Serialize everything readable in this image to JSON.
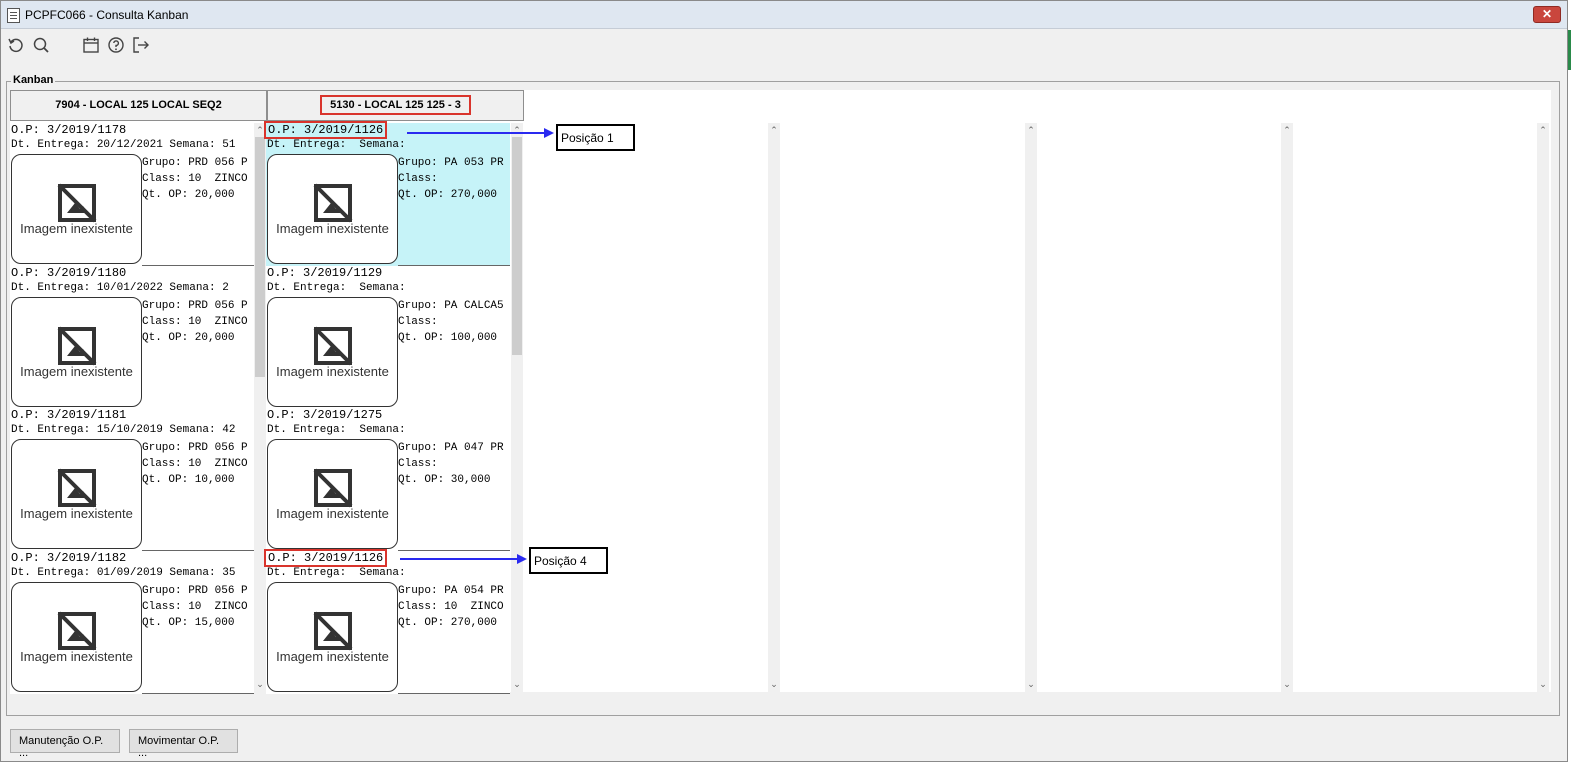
{
  "window": {
    "title": "PCPFC066 - Consulta Kanban",
    "close_label": "✕"
  },
  "toolbar": {
    "icons": [
      "refresh-icon",
      "search-icon",
      "calendar-icon",
      "help-icon",
      "exit-icon"
    ]
  },
  "group": {
    "label": "Kanban"
  },
  "columns": [
    {
      "header": "7904 - LOCAL 125 LOCAL SEQ2",
      "cards": [
        {
          "op": "O.P: 3/2019/1178",
          "dt": "Dt. Entrega: 20/12/2021 Semana: 51",
          "grupo": "Grupo: PRD 056 P",
          "class": "Class: 10  ZINCO",
          "qt": "Qt. OP: 20,000",
          "img_caption": "Imagem inexistente"
        },
        {
          "op": "O.P: 3/2019/1180",
          "dt": "Dt. Entrega: 10/01/2022 Semana: 2",
          "grupo": "Grupo: PRD 056 P",
          "class": "Class: 10  ZINCO",
          "qt": "Qt. OP: 20,000",
          "img_caption": "Imagem inexistente"
        },
        {
          "op": "O.P: 3/2019/1181",
          "dt": "Dt. Entrega: 15/10/2019 Semana: 42",
          "grupo": "Grupo: PRD 056 P",
          "class": "Class: 10  ZINCO",
          "qt": "Qt. OP: 10,000",
          "img_caption": "Imagem inexistente"
        },
        {
          "op": "O.P: 3/2019/1182",
          "dt": "Dt. Entrega: 01/09/2019 Semana: 35",
          "grupo": "Grupo: PRD 056 P",
          "class": "Class: 10  ZINCO",
          "qt": "Qt. OP: 15,000",
          "img_caption": "Imagem inexistente"
        }
      ]
    },
    {
      "header": "5130 - LOCAL 125 125 - 3",
      "cards": [
        {
          "op": "O.P: 3/2019/1126",
          "dt": "Dt. Entrega:  Semana:",
          "grupo": "Grupo: PA 053 PR",
          "class": "Class:",
          "qt": "Qt. OP: 270,000",
          "img_caption": "Imagem inexistente"
        },
        {
          "op": "O.P: 3/2019/1129",
          "dt": "Dt. Entrega:  Semana:",
          "grupo": "Grupo: PA CALCA5",
          "class": "Class:",
          "qt": "Qt. OP: 100,000",
          "img_caption": "Imagem inexistente"
        },
        {
          "op": "O.P: 3/2019/1275",
          "dt": "Dt. Entrega:  Semana:",
          "grupo": "Grupo: PA 047 PR",
          "class": "Class:",
          "qt": "Qt. OP: 30,000",
          "img_caption": "Imagem inexistente"
        },
        {
          "op": "O.P: 3/2019/1126",
          "dt": "Dt. Entrega:  Semana:",
          "grupo": "Grupo: PA 054 PR",
          "class": "Class: 10  ZINCO",
          "qt": "Qt. OP: 270,000",
          "img_caption": "Imagem inexistente"
        }
      ]
    }
  ],
  "callouts": {
    "pos1": "Posição 1",
    "pos4": "Posição 4"
  },
  "buttons": {
    "manutencao": "Manutenção O.P. ...",
    "movimentar": "Movimentar O.P. ..."
  },
  "colors": {
    "highlight": "#d9342c",
    "active_card": "#c6f3f8",
    "arrow": "#2a2af0"
  }
}
